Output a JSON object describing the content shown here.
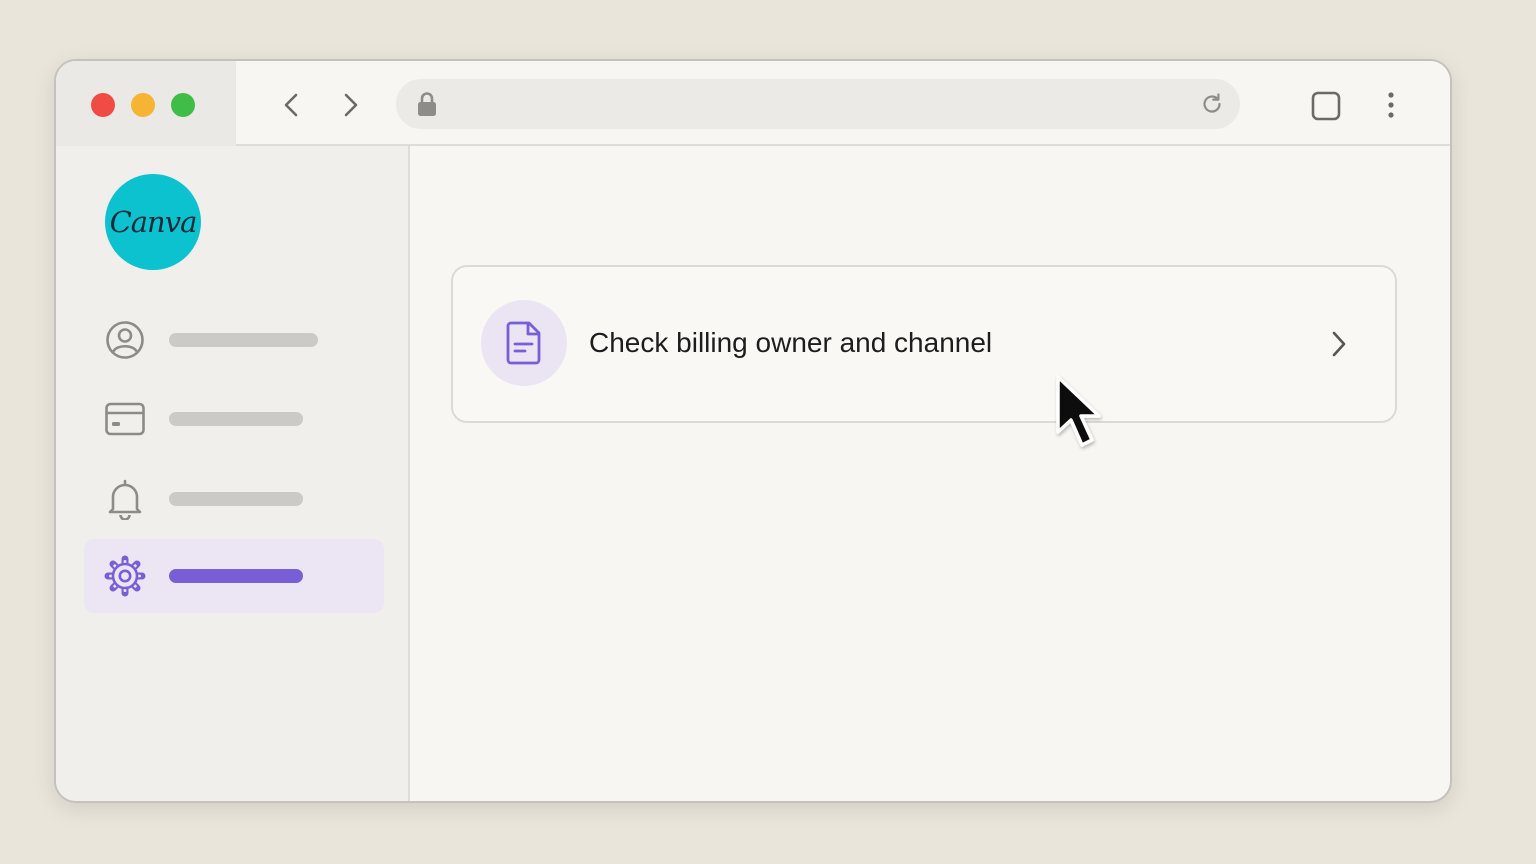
{
  "app": {
    "logo_text": "Canva"
  },
  "sidebar": {
    "items": [
      {
        "icon": "user-circle-icon",
        "active": false
      },
      {
        "icon": "credit-card-icon",
        "active": false
      },
      {
        "icon": "bell-icon",
        "active": false
      },
      {
        "icon": "gear-icon",
        "active": true
      }
    ]
  },
  "main": {
    "card": {
      "icon": "document-icon",
      "label": "Check billing owner and channel"
    }
  },
  "colors": {
    "accent": "#7a5ed6",
    "logo_bg": "#0cc2cf",
    "traffic_red": "#ef4c43",
    "traffic_yellow": "#f5b433",
    "traffic_green": "#3fbd47"
  }
}
